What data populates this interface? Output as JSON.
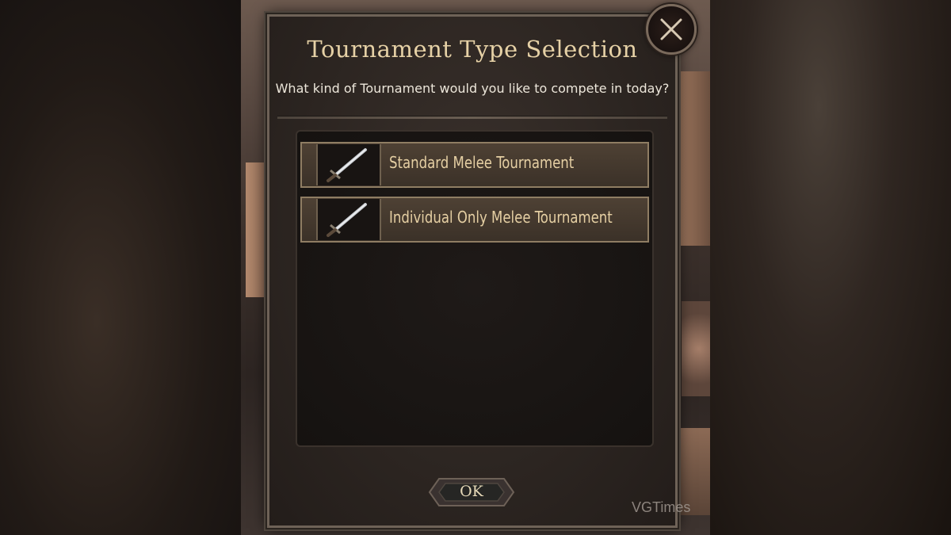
{
  "dialog": {
    "title": "Tournament Type Selection",
    "subtitle": "What kind of Tournament would you like to compete in today?",
    "options": [
      {
        "label": "Standard Melee Tournament",
        "icon": "sword-icon"
      },
      {
        "label": "Individual Only Melee Tournament",
        "icon": "sword-icon"
      }
    ],
    "ok_label": "OK",
    "close_icon": "close-icon"
  },
  "watermark": "VGTimes",
  "colors": {
    "title": "#e6d1a6",
    "option_border": "#8f7d63",
    "option_label": "#e5cfa3"
  }
}
